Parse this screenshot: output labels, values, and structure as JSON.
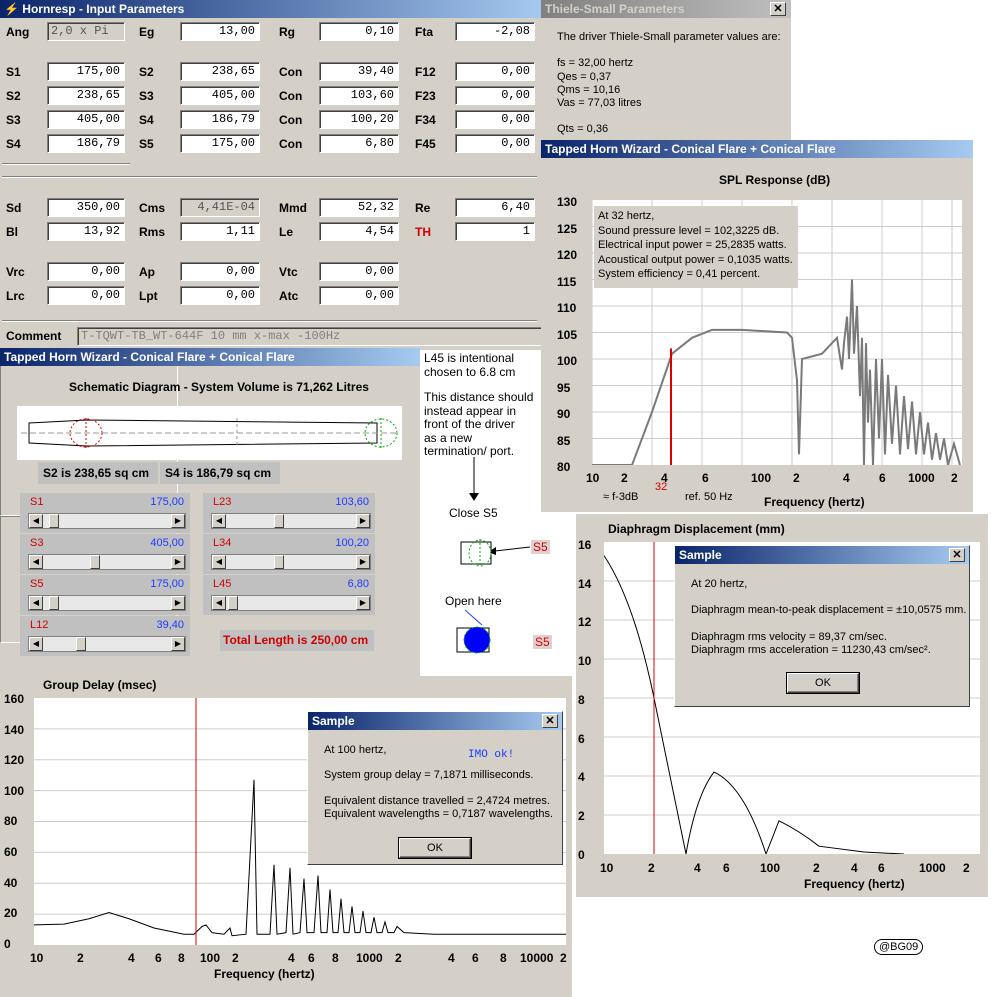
{
  "hornresp": {
    "title": "Hornresp - Input Parameters",
    "rows": [
      [
        {
          "l": "Ang",
          "v": "2,0 x Pi",
          "left": true,
          "ro": true
        },
        {
          "l": "Eg",
          "v": "13,00"
        },
        {
          "l": "Rg",
          "v": "0,10"
        },
        {
          "l": "Fta",
          "v": "-2,08"
        }
      ],
      [
        {
          "l": "S1",
          "v": "175,00"
        },
        {
          "l": "S2",
          "v": "238,65"
        },
        {
          "l": "Con",
          "v": "39,40"
        },
        {
          "l": "F12",
          "v": "0,00"
        }
      ],
      [
        {
          "l": "S2",
          "v": "238,65"
        },
        {
          "l": "S3",
          "v": "405,00"
        },
        {
          "l": "Con",
          "v": "103,60"
        },
        {
          "l": "F23",
          "v": "0,00"
        }
      ],
      [
        {
          "l": "S3",
          "v": "405,00"
        },
        {
          "l": "S4",
          "v": "186,79"
        },
        {
          "l": "Con",
          "v": "100,20"
        },
        {
          "l": "F34",
          "v": "0,00"
        }
      ],
      [
        {
          "l": "S4",
          "v": "186,79"
        },
        {
          "l": "S5",
          "v": "175,00"
        },
        {
          "l": "Con",
          "v": "6,80"
        },
        {
          "l": "F45",
          "v": "0,00"
        }
      ],
      [
        {
          "l": "Sd",
          "v": "350,00"
        },
        {
          "l": "Cms",
          "v": "4,41E-04",
          "ro": true
        },
        {
          "l": "Mmd",
          "v": "52,32"
        },
        {
          "l": "Re",
          "v": "6,40"
        }
      ],
      [
        {
          "l": "Bl",
          "v": "13,92"
        },
        {
          "l": "Rms",
          "v": "1,11"
        },
        {
          "l": "Le",
          "v": "4,54"
        },
        {
          "l": "TH",
          "v": "1",
          "red": true
        }
      ],
      [
        {
          "l": "Vrc",
          "v": "0,00"
        },
        {
          "l": "Ap",
          "v": "0,00"
        },
        {
          "l": "Vtc",
          "v": "0,00"
        }
      ],
      [
        {
          "l": "Lrc",
          "v": "0,00"
        },
        {
          "l": "Lpt",
          "v": "0,00"
        },
        {
          "l": "Atc",
          "v": "0,00"
        }
      ]
    ],
    "comment_label": "Comment",
    "comment": "T-TQWT-TB_WT-644F 10 mm x-max -100Hz"
  },
  "ts": {
    "title": "Thiele-Small Parameters",
    "intro": "The driver Thiele-Small parameter values are:",
    "fs": "fs = 32,00 hertz",
    "qes": "Qes = 0,37",
    "qms": "Qms = 10,16",
    "vas": "Vas = 77,03 litres",
    "qts": "Qts = 0,36"
  },
  "spl": {
    "title": "Tapped Horn Wizard - Conical Flare + Conical Flare",
    "chart_title": "SPL Response (dB)",
    "info": [
      "At 32 hertz,",
      "Sound pressure level = 102,3225 dB.",
      "Electrical input power = 25,2835 watts.",
      "Acoustical output power = 0,1035 watts.",
      "System efficiency = 0,41 percent."
    ],
    "f3db": "≈ f-3dB",
    "f3db_val": "32",
    "ref": "ref. 50 Hz",
    "xlabel": "Frequency (hertz)",
    "yticks": [
      "130",
      "125",
      "120",
      "115",
      "110",
      "105",
      "100",
      "95",
      "90",
      "85",
      "80"
    ],
    "xticks": [
      "10",
      "2",
      "4",
      "6",
      "100",
      "2",
      "4",
      "6",
      "1000",
      "2"
    ]
  },
  "tw": {
    "title": "Tapped Horn Wizard - Conical Flare + Conical Flare",
    "schematic_title": "Schematic Diagram - System Volume is 71,262 Litres",
    "s2": "S2 is 238,65 sq cm",
    "s4": "S4 is 186,79 sq cm",
    "sliders": [
      {
        "n": "S1",
        "v": "175,00"
      },
      {
        "n": "S3",
        "v": "405,00"
      },
      {
        "n": "S5",
        "v": "175,00"
      },
      {
        "n": "L12",
        "v": "39,40"
      },
      {
        "n": "L23",
        "v": "103,60"
      },
      {
        "n": "L34",
        "v": "100,20"
      },
      {
        "n": "L45",
        "v": "6,80"
      }
    ],
    "total": "Total Length is 250,00 cm"
  },
  "note": {
    "line1": "L45 is intentional",
    "line2": "chosen to 6.8 cm",
    "p1": "This distance should",
    "p2": "instead appear in",
    "p3": "front of the driver",
    "p4": "as a  new",
    "p5": "termination/ port.",
    "close": "Close S5",
    "open": "Open here",
    "s5a": "S5",
    "s5b": "S5"
  },
  "gd": {
    "title": "Group Delay (msec)",
    "xlabel": "Frequency (hertz)",
    "yticks": [
      "160",
      "140",
      "120",
      "100",
      "80",
      "60",
      "40",
      "20",
      "0"
    ],
    "xticks": [
      "10",
      "2",
      "4",
      "6",
      "8",
      "100",
      "2",
      "4",
      "6",
      "8",
      "1000",
      "2",
      "4",
      "6",
      "8",
      "10000",
      "2"
    ],
    "dialog": {
      "title": "Sample",
      "l1": "At 100 hertz,",
      "note": "IMO ok!",
      "l2": "System group delay = 7,1871 milliseconds.",
      "l3": "Equivalent distance travelled = 2,4724 metres.",
      "l4": "Equivalent wavelengths = 0,7187 wavelengths.",
      "ok": "OK"
    }
  },
  "dd": {
    "title": "Diaphragm Displacement (mm)",
    "xlabel": "Frequency (hertz)",
    "yticks": [
      "16",
      "14",
      "12",
      "10",
      "8",
      "6",
      "4",
      "2",
      "0"
    ],
    "xticks": [
      "10",
      "2",
      "4",
      "6",
      "100",
      "2",
      "4",
      "6",
      "1000",
      "2"
    ],
    "dialog": {
      "title": "Sample",
      "l1": "At 20 hertz,",
      "l2": "Diaphragm mean-to-peak displacement = ±10,0575 mm.",
      "l3": "Diaphragm rms velocity = 89,37 cm/sec.",
      "l4": "Diaphragm rms acceleration = 11230,43 cm/sec².",
      "ok": "OK"
    }
  },
  "watermark": "@BG09"
}
